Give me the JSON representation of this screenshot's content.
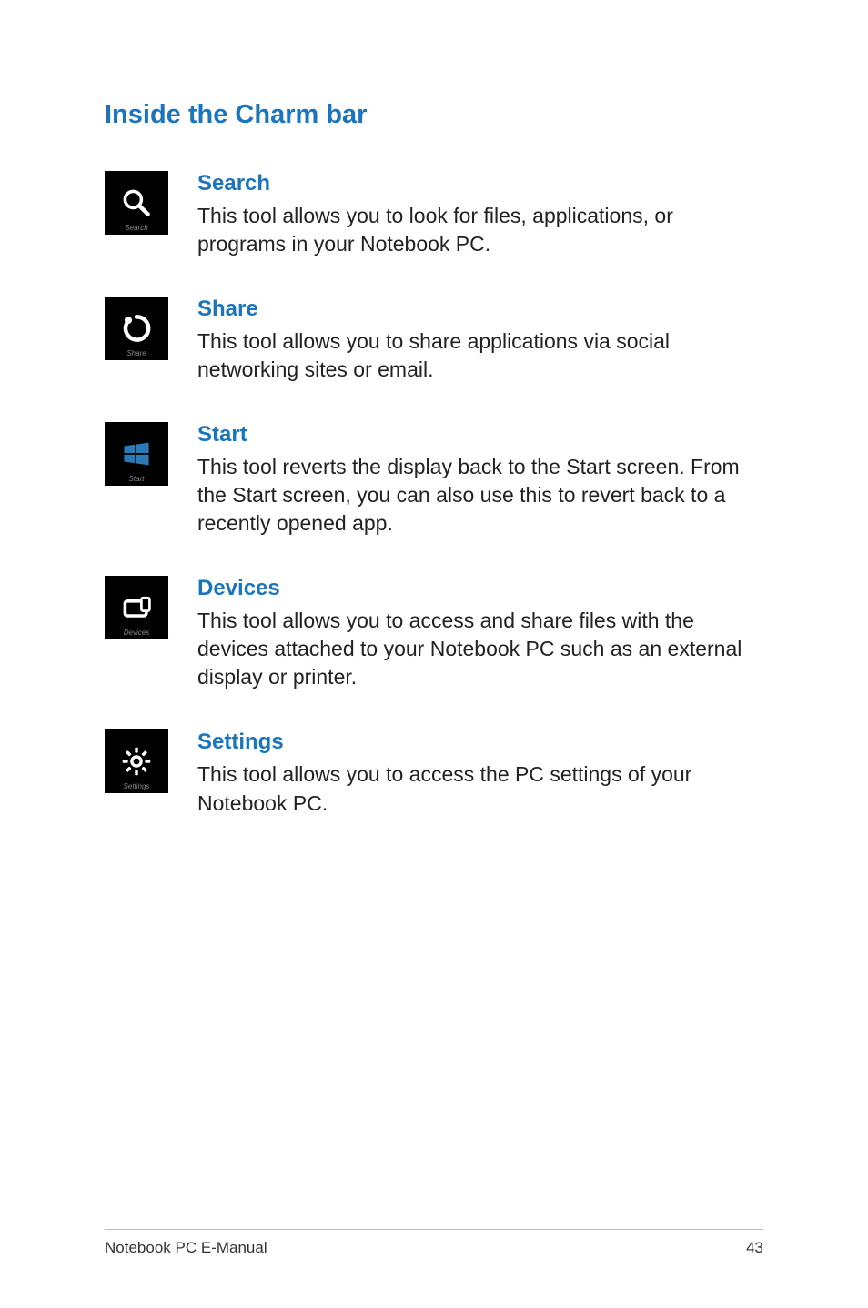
{
  "section_title": "Inside the Charm bar",
  "charms": [
    {
      "title": "Search",
      "icon_label": "Search",
      "description": "This tool allows you to look for files, applications, or programs in your Notebook PC."
    },
    {
      "title": "Share",
      "icon_label": "Share",
      "description": "This tool allows you to share applications via social networking sites or email."
    },
    {
      "title": "Start",
      "icon_label": "Start",
      "description": "This tool reverts the display back to the Start screen. From the Start screen, you can also use this to revert back to a recently opened app."
    },
    {
      "title": "Devices",
      "icon_label": "Devices",
      "description": "This tool allows you to access and share files with the devices attached to your Notebook PC such as an external display or printer."
    },
    {
      "title": "Settings",
      "icon_label": "Settings",
      "description": "This tool allows you to access the PC settings of your Notebook PC."
    }
  ],
  "footer": {
    "text": "Notebook PC E-Manual",
    "page": "43"
  }
}
